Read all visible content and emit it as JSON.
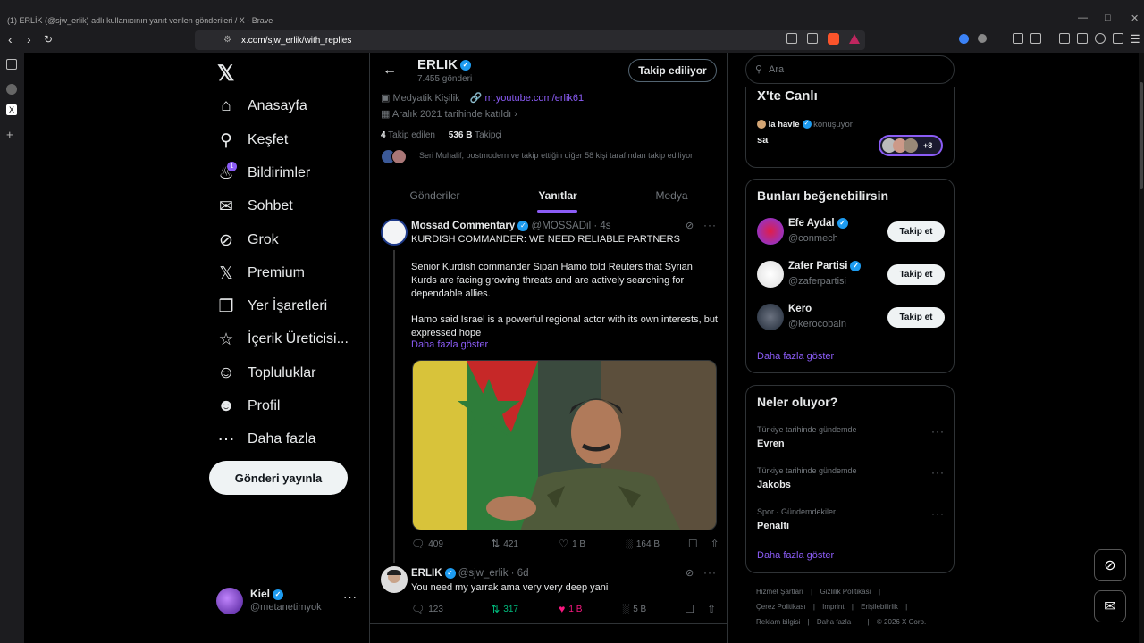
{
  "browser": {
    "window_title": "(1) ERLİK (@sjw_erlik) adlı kullanıcının yanıt verilen gönderileri / X - Brave",
    "url": "x.com/sjw_erlik/with_replies"
  },
  "nav": {
    "items": [
      {
        "label": "Anasayfa",
        "icon": "home-icon"
      },
      {
        "label": "Keşfet",
        "icon": "search-icon"
      },
      {
        "label": "Bildirimler",
        "icon": "bell-icon",
        "badge": "1"
      },
      {
        "label": "Sohbet",
        "icon": "mail-icon"
      },
      {
        "label": "Grok",
        "icon": "grok-icon"
      },
      {
        "label": "Premium",
        "icon": "x-logo-icon"
      },
      {
        "label": "Yer İşaretleri",
        "icon": "bookmark-icon"
      },
      {
        "label": "İçerik Üreticisi...",
        "icon": "creator-icon"
      },
      {
        "label": "Topluluklar",
        "icon": "people-icon"
      },
      {
        "label": "Profil",
        "icon": "person-icon"
      },
      {
        "label": "Daha fazla",
        "icon": "more-circle-icon"
      }
    ],
    "post_button": "Gönderi yayınla",
    "account": {
      "name": "Kiel",
      "handle": "@metanetimyok"
    }
  },
  "profile": {
    "name": "ERLIK",
    "post_count": "7.455 gönderi",
    "follow_button": "Takip ediliyor",
    "category": "Medyatik Kişilik",
    "link": "m.youtube.com/erlik61",
    "joined": "Aralık 2021 tarihinde katıldı",
    "following_count": "4",
    "following_label": "Takip edilen",
    "followers_count": "536 B",
    "followers_label": "Takipçi",
    "followed_by": "Seri Muhalif, postmodern ve takip ettiğin diğer 58 kişi tarafından takip ediliyor"
  },
  "tabs": [
    "Gönderiler",
    "Yanıtlar",
    "Medya"
  ],
  "tweets": [
    {
      "author": "Mossad Commentary",
      "handle": "@MOSSADil",
      "time": "4s",
      "headline": "KURDISH COMMANDER: WE NEED RELIABLE PARTNERS",
      "para1": "Senior Kurdish commander Sipan Hamo told Reuters that Syrian Kurds are facing growing threats and are actively searching for dependable allies.",
      "para2": "Hamo said Israel is a powerful regional actor with its own interests, but expressed hope",
      "show_more": "Daha fazla göster",
      "replies": "409",
      "retweets": "421",
      "likes": "1 B",
      "views": "164 B"
    },
    {
      "author": "ERLIK",
      "handle": "@sjw_erlik",
      "time": "6d",
      "text": "You need my yarrak ama very very deep yani",
      "replies": "123",
      "retweets": "317",
      "likes": "1 B",
      "views": "5 B"
    }
  ],
  "search": {
    "placeholder": "Ara"
  },
  "live": {
    "title": "X'te Canlı",
    "host": "la havle",
    "status": "konuşuyor",
    "space_title": "sa",
    "listeners_more": "+8"
  },
  "suggestions": {
    "title": "Bunları beğenebilirsin",
    "users": [
      {
        "name": "Efe Aydal",
        "handle": "@conmech",
        "button": "Takip et"
      },
      {
        "name": "Zafer Partisi",
        "handle": "@zaferpartisi",
        "button": "Takip et"
      },
      {
        "name": "Kero",
        "handle": "@kerocobain",
        "button": "Takip et"
      }
    ],
    "show_more": "Daha fazla göster"
  },
  "trends": {
    "title": "Neler oluyor?",
    "items": [
      {
        "meta": "Türkiye tarihinde gündemde",
        "name": "Evren"
      },
      {
        "meta": "Türkiye tarihinde gündemde",
        "name": "Jakobs"
      },
      {
        "meta": "Spor · Gündemdekiler",
        "name": "Penaltı"
      }
    ],
    "show_more": "Daha fazla göster"
  },
  "footer": {
    "line1": [
      "Hizmet Şartları",
      "Gizlilik Politikası"
    ],
    "line2": [
      "Çerez Politikası",
      "Imprint",
      "Erişilebilirlik"
    ],
    "line3": [
      "Reklam bilgisi",
      "Daha fazla ···",
      "© 2026 X Corp."
    ]
  },
  "colors": {
    "accent": "#8b5cf6",
    "verified": "#1d9bf0",
    "retweet": "#00ba7c",
    "like": "#f91880"
  }
}
